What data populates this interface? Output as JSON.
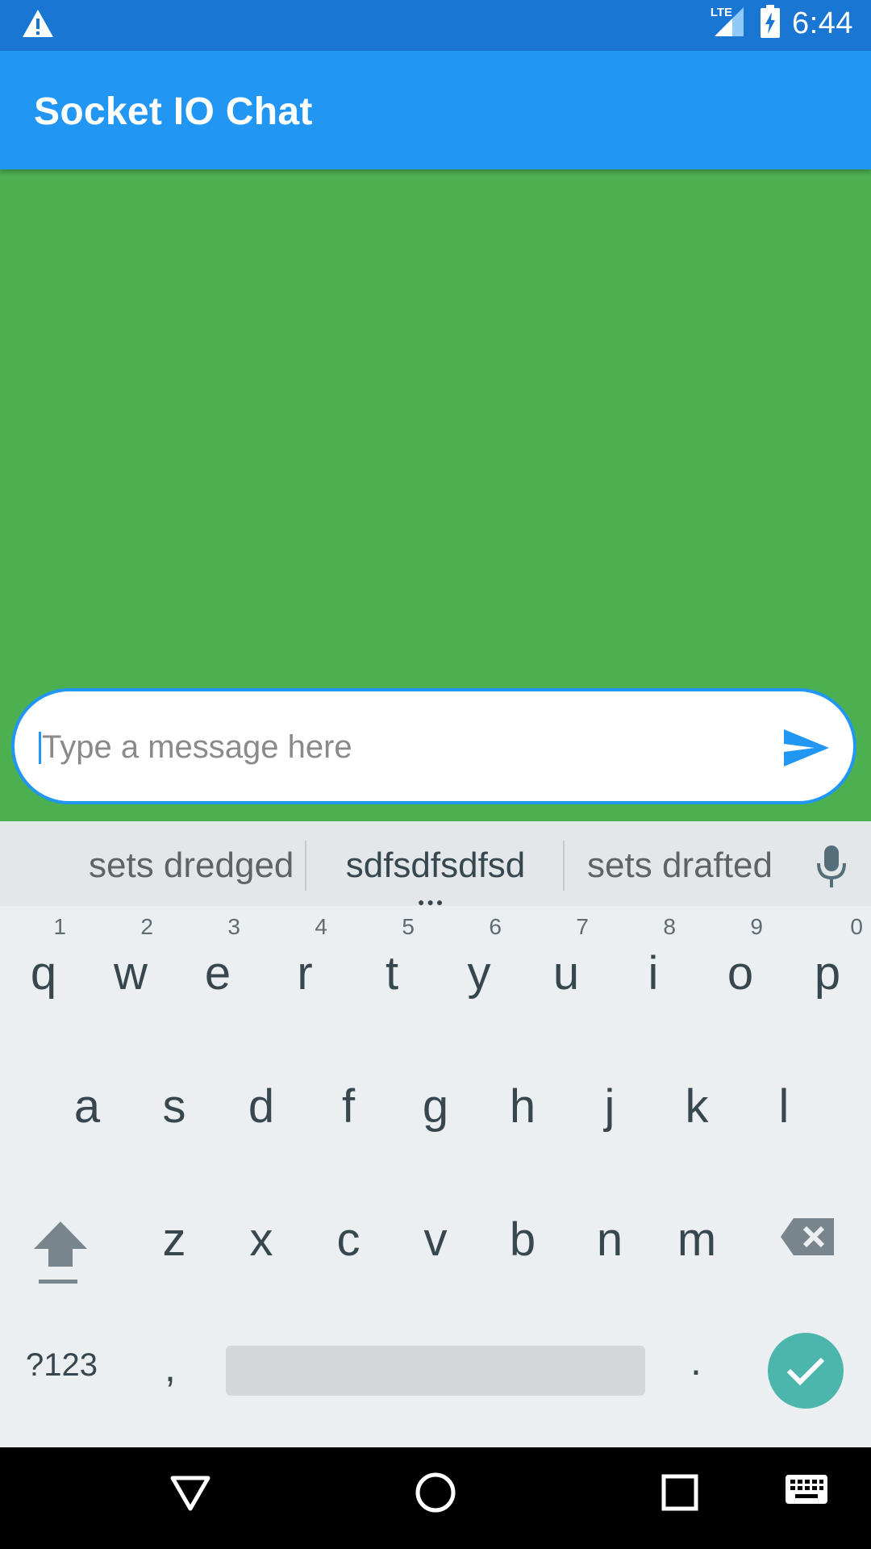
{
  "status_bar": {
    "time": "6:44",
    "network": "LTE",
    "icons": [
      "warning-icon",
      "signal-icon",
      "battery-charging-icon"
    ],
    "background": "#1976D2"
  },
  "app_bar": {
    "title": "Socket IO Chat",
    "background": "#2196F3"
  },
  "chat": {
    "background": "#4CAF50",
    "input": {
      "placeholder": "Type a message here",
      "value": ""
    },
    "send_icon": "send-icon",
    "accent": "#2196F3"
  },
  "keyboard": {
    "suggestions": [
      "sets dredged",
      "sdfsdfsdfsd",
      "sets drafted"
    ],
    "row1": [
      {
        "letter": "q",
        "digit": "1"
      },
      {
        "letter": "w",
        "digit": "2"
      },
      {
        "letter": "e",
        "digit": "3"
      },
      {
        "letter": "r",
        "digit": "4"
      },
      {
        "letter": "t",
        "digit": "5"
      },
      {
        "letter": "y",
        "digit": "6"
      },
      {
        "letter": "u",
        "digit": "7"
      },
      {
        "letter": "i",
        "digit": "8"
      },
      {
        "letter": "o",
        "digit": "9"
      },
      {
        "letter": "p",
        "digit": "0"
      }
    ],
    "row2": [
      "a",
      "s",
      "d",
      "f",
      "g",
      "h",
      "j",
      "k",
      "l"
    ],
    "row3": [
      "z",
      "x",
      "c",
      "v",
      "b",
      "n",
      "m"
    ],
    "symbols_label": "?123",
    "comma": ",",
    "period": ".",
    "enter_color": "#4DB6AC"
  },
  "nav_bar": {
    "buttons": [
      "back-icon",
      "home-icon",
      "recents-icon",
      "keyboard-switch-icon"
    ]
  }
}
